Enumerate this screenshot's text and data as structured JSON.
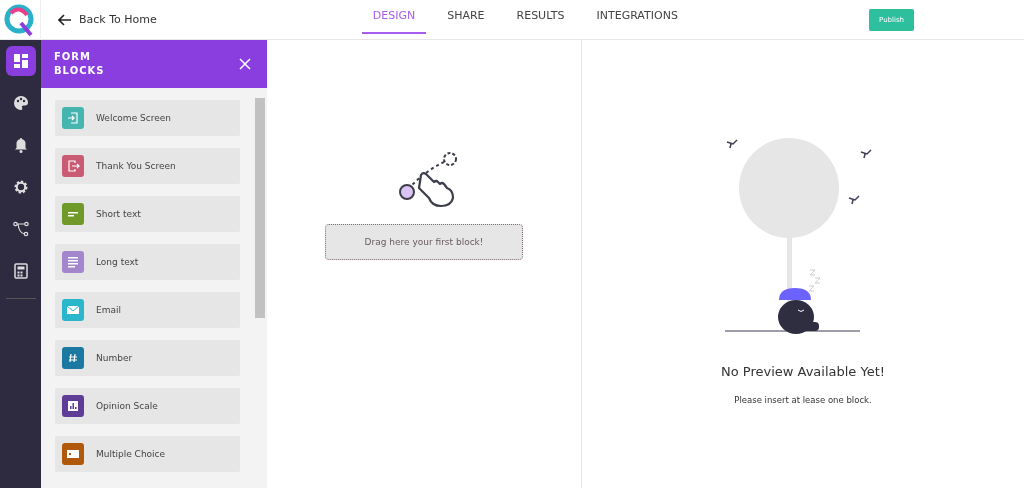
{
  "header": {
    "back_link": "Back To Home",
    "publish_button": "Publish"
  },
  "tabs": [
    {
      "label": "DESIGN",
      "selected": true
    },
    {
      "label": "SHARE",
      "selected": false
    },
    {
      "label": "RESULTS",
      "selected": false
    },
    {
      "label": "INTEGRATIONS",
      "selected": false
    }
  ],
  "rail": [
    {
      "kind": "blocks",
      "selected": true
    },
    {
      "kind": "palette",
      "selected": false
    },
    {
      "kind": "bell",
      "selected": false
    },
    {
      "kind": "gear",
      "selected": false
    },
    {
      "kind": "flow",
      "selected": false
    },
    {
      "kind": "calculator",
      "selected": false
    }
  ],
  "panel": {
    "title": "FORM BLOCKS",
    "blocks": [
      {
        "label": "Welcome Screen",
        "kind": "enter",
        "color": "#45b5b0"
      },
      {
        "label": "Thank You Screen",
        "kind": "exit",
        "color": "#c95b72"
      },
      {
        "label": "Short text",
        "kind": "short",
        "color": "#6f9a2a"
      },
      {
        "label": "Long text",
        "kind": "long",
        "color": "#a486cc"
      },
      {
        "label": "Email",
        "kind": "mail",
        "color": "#2ab7cc"
      },
      {
        "label": "Number",
        "kind": "number",
        "color": "#1b78a0"
      },
      {
        "label": "Opinion Scale",
        "kind": "scale",
        "color": "#5f3c96"
      },
      {
        "label": "Multiple Choice",
        "kind": "choice",
        "color": "#b0580c"
      }
    ]
  },
  "canvas": {
    "drop_zone": "Drag here your first block!"
  },
  "preview": {
    "title": "No Preview Available Yet!",
    "message": "Please insert at lease one block."
  }
}
